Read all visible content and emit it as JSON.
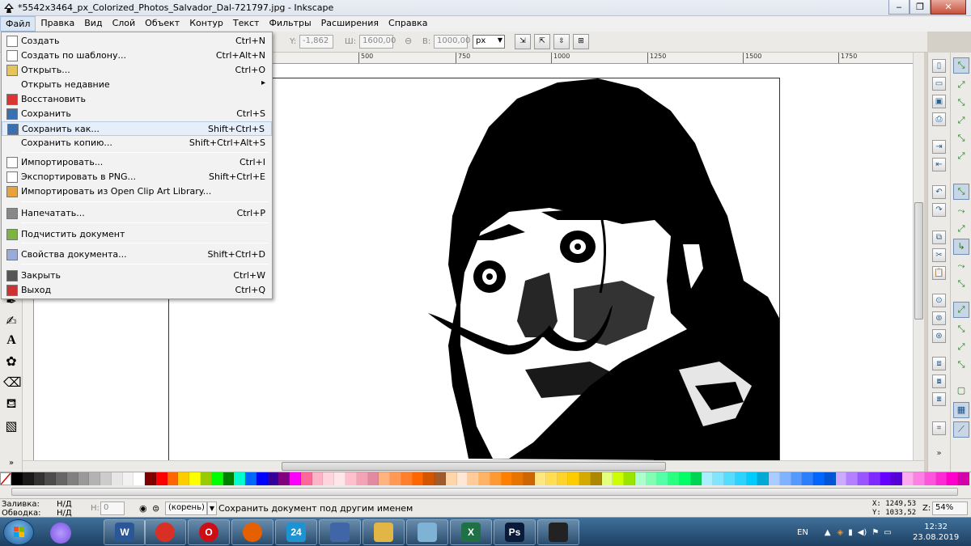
{
  "window": {
    "title": "*5542x3464_px_Colorized_Photos_Salvador_Dal-721797.jpg - Inkscape",
    "minimize": "‒",
    "maximize": "❐",
    "close": "✕"
  },
  "menubar": [
    "Файл",
    "Правка",
    "Вид",
    "Слой",
    "Объект",
    "Контур",
    "Текст",
    "Фильтры",
    "Расширения",
    "Справка"
  ],
  "toolbar": {
    "y_label": "Y:",
    "y_value": "-1,862",
    "w_label": "Ш:",
    "w_value": "1600,00",
    "h_label": "В:",
    "h_value": "1000,00",
    "unit": "px"
  },
  "ruler": {
    "top_ticks": [
      "500",
      "750",
      "1000",
      "1250",
      "1500",
      "1750"
    ]
  },
  "file_menu": {
    "items": [
      {
        "label": "Создать",
        "shortcut": "Ctrl+N",
        "icon": "new-document-icon"
      },
      {
        "label": "Создать по шаблону...",
        "shortcut": "Ctrl+Alt+N",
        "icon": "template-icon"
      },
      {
        "label": "Открыть...",
        "shortcut": "Ctrl+O",
        "icon": "open-folder-icon"
      },
      {
        "label": "Открыть недавние",
        "shortcut": "",
        "icon": "",
        "submenu": "▸"
      },
      {
        "label": "Восстановить",
        "shortcut": "",
        "icon": "revert-icon"
      },
      {
        "label": "Сохранить",
        "shortcut": "Ctrl+S",
        "icon": "save-icon"
      },
      {
        "label": "Сохранить как...",
        "shortcut": "Shift+Ctrl+S",
        "icon": "save-as-icon"
      },
      {
        "label": "Сохранить копию...",
        "shortcut": "Shift+Ctrl+Alt+S",
        "icon": ""
      },
      {
        "label": "Импортировать...",
        "shortcut": "Ctrl+I",
        "icon": "import-icon"
      },
      {
        "label": "Экспортировать в PNG...",
        "shortcut": "Shift+Ctrl+E",
        "icon": "export-png-icon"
      },
      {
        "label": "Импортировать из Open Clip Art Library...",
        "shortcut": "",
        "icon": "clipart-icon"
      },
      {
        "label": "Напечатать...",
        "shortcut": "Ctrl+P",
        "icon": "print-icon"
      },
      {
        "label": "Подчистить документ",
        "shortcut": "",
        "icon": "cleanup-icon"
      },
      {
        "label": "Свойства документа...",
        "shortcut": "Shift+Ctrl+D",
        "icon": "document-properties-icon"
      },
      {
        "label": "Закрыть",
        "shortcut": "Ctrl+W",
        "icon": "close-document-icon"
      },
      {
        "label": "Выход",
        "shortcut": "Ctrl+Q",
        "icon": "quit-icon"
      }
    ]
  },
  "palette": {
    "colors": [
      "#000000",
      "#1a1a1a",
      "#333333",
      "#4d4d4d",
      "#666666",
      "#808080",
      "#999999",
      "#b3b3b3",
      "#cccccc",
      "#e6e6e6",
      "#f2f2f2",
      "#ffffff",
      "#800000",
      "#ff0000",
      "#ff6600",
      "#ffcc00",
      "#ffff00",
      "#99cc00",
      "#00ff00",
      "#008000",
      "#00ffcc",
      "#0066ff",
      "#0000ff",
      "#330099",
      "#800080",
      "#ff00ff",
      "#ff6699",
      "#ffb3c6",
      "#ffd5dd",
      "#ffe6ea",
      "#ffc0cb",
      "#f4a3b6",
      "#e38aa3",
      "#ffb380",
      "#ff9955",
      "#ff7f2a",
      "#ff6600",
      "#d45500",
      "#a05a2c",
      "#ffd5aa",
      "#ffe6d5",
      "#ffcc99",
      "#ffb366",
      "#ff9933",
      "#ff8000",
      "#e67300",
      "#cc6600",
      "#ffe680",
      "#ffdd55",
      "#ffd42a",
      "#ffcc00",
      "#d4aa00",
      "#aa8800",
      "#e5ff80",
      "#ccff00",
      "#99e500",
      "#aaffcc",
      "#80ffb3",
      "#55ffaa",
      "#2aff80",
      "#00ff66",
      "#00d455",
      "#aaeeff",
      "#80e5ff",
      "#55ddff",
      "#2ad4ff",
      "#00ccff",
      "#00aad4",
      "#aaccff",
      "#80b3ff",
      "#5599ff",
      "#2a7fff",
      "#0066ff",
      "#0055d4",
      "#ccaaff",
      "#b380ff",
      "#9955ff",
      "#7f2aff",
      "#6600ff",
      "#5500d4",
      "#ffaaee",
      "#ff80e5",
      "#ff55dd",
      "#ff2ad4",
      "#ff00cc",
      "#d400aa"
    ]
  },
  "statusbar": {
    "fill_label": "Заливка:",
    "fill_value": "Н/Д",
    "stroke_label": "Обводка:",
    "stroke_value": "Н/Д",
    "h_label": "Н:",
    "h_value": "0",
    "layer": "(корень)",
    "message": "Сохранить документ под другим именем",
    "x_coord": "X: 1249,53",
    "y_coord": "Y: 1033,52",
    "zoom_label": "Z:",
    "zoom_value": "54%"
  },
  "taskbar": {
    "apps": [
      {
        "name": "word",
        "glyph": "W",
        "color": "#2b5797"
      },
      {
        "name": "chrome",
        "glyph": "",
        "color": "#d93025"
      },
      {
        "name": "opera",
        "glyph": "O",
        "color": "#cc0f16"
      },
      {
        "name": "firefox",
        "glyph": "",
        "color": "#e66000"
      },
      {
        "name": "24",
        "glyph": "24",
        "color": "#1f93d1"
      },
      {
        "name": "network",
        "glyph": "",
        "color": "#4066a8"
      },
      {
        "name": "explorer",
        "glyph": "",
        "color": "#e2b646"
      },
      {
        "name": "notepad",
        "glyph": "",
        "color": "#7fb3d6"
      },
      {
        "name": "excel",
        "glyph": "X",
        "color": "#1e7145"
      },
      {
        "name": "photoshop",
        "glyph": "Ps",
        "color": "#0a1b3a"
      },
      {
        "name": "inkscape",
        "glyph": "",
        "color": "#222222"
      }
    ],
    "lang": "EN",
    "time": "12:32",
    "date": "23.08.2019"
  }
}
